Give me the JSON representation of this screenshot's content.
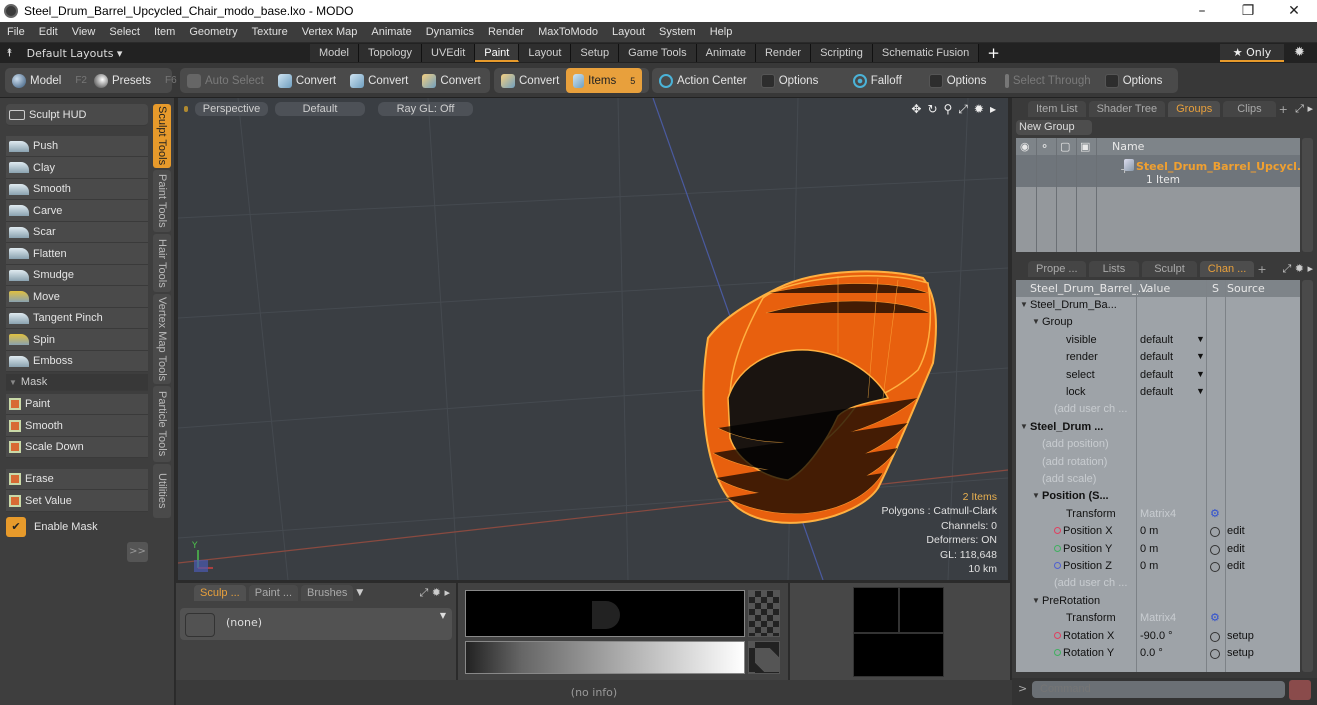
{
  "window": {
    "title": "Steel_Drum_Barrel_Upcycled_Chair_modo_base.lxo - MODO",
    "controls": [
      "–",
      "❐",
      "✕"
    ]
  },
  "menu": [
    "File",
    "Edit",
    "View",
    "Select",
    "Item",
    "Geometry",
    "Texture",
    "Vertex Map",
    "Animate",
    "Dynamics",
    "Render",
    "MaxToModo",
    "Layout",
    "System",
    "Help"
  ],
  "layoutbar": {
    "default_layouts": "Default Layouts ▾",
    "tabs": [
      "Model",
      "Topology",
      "UVEdit",
      "Paint",
      "Layout",
      "Setup",
      "Game Tools",
      "Animate",
      "Render",
      "Scripting",
      "Schematic Fusion"
    ],
    "active_tab": "Paint",
    "add": "+",
    "only": "★ Only"
  },
  "toolbar": {
    "model": "Model",
    "model_key": "F2",
    "presets": "Presets",
    "presets_key": "F6",
    "auto_select": "Auto Select",
    "convert": [
      "Convert",
      "Convert",
      "Convert",
      "Convert"
    ],
    "items": "Items",
    "items_key": "5",
    "action_center": "Action Center",
    "options1": "Options",
    "falloff": "Falloff",
    "options2": "Options",
    "select_through": "Select Through",
    "options3": "Options"
  },
  "left_panel": {
    "sculpt_hud": "Sculpt HUD",
    "tools": [
      "Push",
      "Clay",
      "Smooth",
      "Carve",
      "Scar",
      "Flatten",
      "Smudge",
      "Move",
      "Tangent Pinch",
      "Spin",
      "Emboss"
    ],
    "mask_header": "Mask",
    "mask_tools": [
      "Paint",
      "Smooth",
      "Scale Down"
    ],
    "mask_tools2": [
      "Erase",
      "Set Value"
    ],
    "enable_mask": "Enable Mask",
    "enable_mask_checked": true,
    "expand": ">>",
    "vertical_tabs": [
      "Sculpt Tools",
      "Paint Tools",
      "Hair Tools",
      "Vertex Map Tools",
      "Particle Tools",
      "Utilities"
    ],
    "active_vtab": "Sculpt Tools"
  },
  "viewport": {
    "view": "Perspective",
    "shading": "Default",
    "raygl": "Ray GL: Off",
    "info": {
      "items": "2 Items",
      "polygons": "Polygons : Catmull-Clark",
      "channels": "Channels: 0",
      "deformers": "Deformers: ON",
      "gl": "GL: 118,648",
      "scale": "10 km"
    },
    "axis_label": "Y"
  },
  "bottom_panel": {
    "tabs": [
      "Sculp ...",
      "Paint ...",
      "Brushes"
    ],
    "active_tab": "Sculp ...",
    "brush": "(none)"
  },
  "status": "(no info)",
  "groups_panel": {
    "tabs": [
      "Item List",
      "Shader Tree",
      "Groups",
      "Clips"
    ],
    "active_tab": "Groups",
    "new_group": "New Group",
    "col_name": "Name",
    "group_name": "Steel_Drum_Barrel_Upcycl...",
    "group_count": "1 Item"
  },
  "channels_panel": {
    "tabs": [
      "Prope ...",
      "Lists",
      "Sculpt",
      "Chan ..."
    ],
    "active_tab": "Chan ...",
    "headers": {
      "name": "Steel_Drum_Barrel_...",
      "value": "Value",
      "s": "S",
      "source": "Source"
    },
    "rows": [
      {
        "name": "Steel_Drum_Ba...",
        "value": "",
        "source": "",
        "indent": 0,
        "kind": "item"
      },
      {
        "name": "Group",
        "value": "",
        "source": "",
        "indent": 1,
        "kind": "item"
      },
      {
        "name": "visible",
        "value": "default",
        "source": "",
        "indent": 3,
        "kind": "dropdown"
      },
      {
        "name": "render",
        "value": "default",
        "source": "",
        "indent": 3,
        "kind": "dropdown"
      },
      {
        "name": "select",
        "value": "default",
        "source": "",
        "indent": 3,
        "kind": "dropdown"
      },
      {
        "name": "lock",
        "value": "default",
        "source": "",
        "indent": 3,
        "kind": "dropdown"
      },
      {
        "name": "(add user ch ...",
        "value": "",
        "source": "",
        "indent": 2,
        "kind": "dim"
      },
      {
        "name": "Steel_Drum ...",
        "value": "",
        "source": "",
        "indent": 0,
        "kind": "bold"
      },
      {
        "name": "(add position)",
        "value": "",
        "source": "",
        "indent": 1,
        "kind": "dim"
      },
      {
        "name": "(add rotation)",
        "value": "",
        "source": "",
        "indent": 1,
        "kind": "dim"
      },
      {
        "name": "(add scale)",
        "value": "",
        "source": "",
        "indent": 1,
        "kind": "dim"
      },
      {
        "name": "Position (S...",
        "value": "",
        "source": "",
        "indent": 1,
        "kind": "bold"
      },
      {
        "name": "Transform",
        "value": "Matrix4",
        "source": "",
        "indent": 3,
        "kind": "matrix"
      },
      {
        "name": "Position X",
        "value": "0 m",
        "source": "edit",
        "indent": 2,
        "kind": "x"
      },
      {
        "name": "Position Y",
        "value": "0 m",
        "source": "edit",
        "indent": 2,
        "kind": "y"
      },
      {
        "name": "Position Z",
        "value": "0 m",
        "source": "edit",
        "indent": 2,
        "kind": "z"
      },
      {
        "name": "(add user ch ...",
        "value": "",
        "source": "",
        "indent": 2,
        "kind": "dim"
      },
      {
        "name": "PreRotation",
        "value": "",
        "source": "",
        "indent": 1,
        "kind": "item"
      },
      {
        "name": "Transform",
        "value": "Matrix4",
        "source": "",
        "indent": 3,
        "kind": "matrix"
      },
      {
        "name": "Rotation X",
        "value": "-90.0 °",
        "source": "setup",
        "indent": 2,
        "kind": "x"
      },
      {
        "name": "Rotation Y",
        "value": "0.0 °",
        "source": "setup",
        "indent": 2,
        "kind": "y"
      }
    ]
  },
  "command": {
    "placeholder": "Command",
    "prompt": ">"
  },
  "colors": {
    "accent": "#e79a2b",
    "selected_text": "#f0a030",
    "mesh": "#f07a18",
    "mesh_wire": "#ffb040"
  }
}
